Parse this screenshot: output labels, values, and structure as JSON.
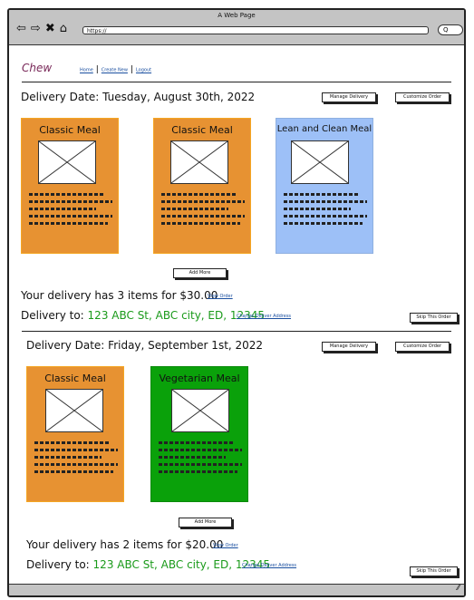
{
  "window": {
    "title": "A Web Page",
    "url": "https://",
    "search": "Q"
  },
  "nav": {
    "logo": "Chew",
    "links": [
      "Home",
      "Create New",
      "Logout"
    ]
  },
  "orders": [
    {
      "date": "Delivery Date: Tuesday, August 30th, 2022",
      "manage": "Manage Delivery",
      "customize": "Customize Order",
      "meals": [
        {
          "name": "Classic Meal",
          "color": "#e79232"
        },
        {
          "name": "Classic Meal",
          "color": "#e79232"
        },
        {
          "name": "Lean and  Clean Meal",
          "color": "#9dc0f7"
        }
      ],
      "add_more": "Add More",
      "summary": "Your delivery has 3 items for $30.00",
      "view_order": "View Order",
      "delivery_label": "Delivery to:",
      "address": "123 ABC St, ABC city, ED, 12345",
      "change_address": "Change Deliver Address",
      "skip": "Skip This Order"
    },
    {
      "date": "Delivery Date: Friday, September 1st, 2022",
      "manage": "Manage Delivery",
      "customize": "Customize Order",
      "meals": [
        {
          "name": "Classic Meal",
          "color": "#e79232"
        },
        {
          "name": "Vegetarian Meal",
          "color": "#0aa10a"
        }
      ],
      "add_more": "Add More",
      "summary": "Your delivery has 2 items for $20.00",
      "view_order": "View Order",
      "delivery_label": "Delivery to:",
      "address": "123 ABC St, ABC city, ED, 12345",
      "change_address": "Change Deliver Address",
      "skip": "Skip This Order"
    }
  ]
}
